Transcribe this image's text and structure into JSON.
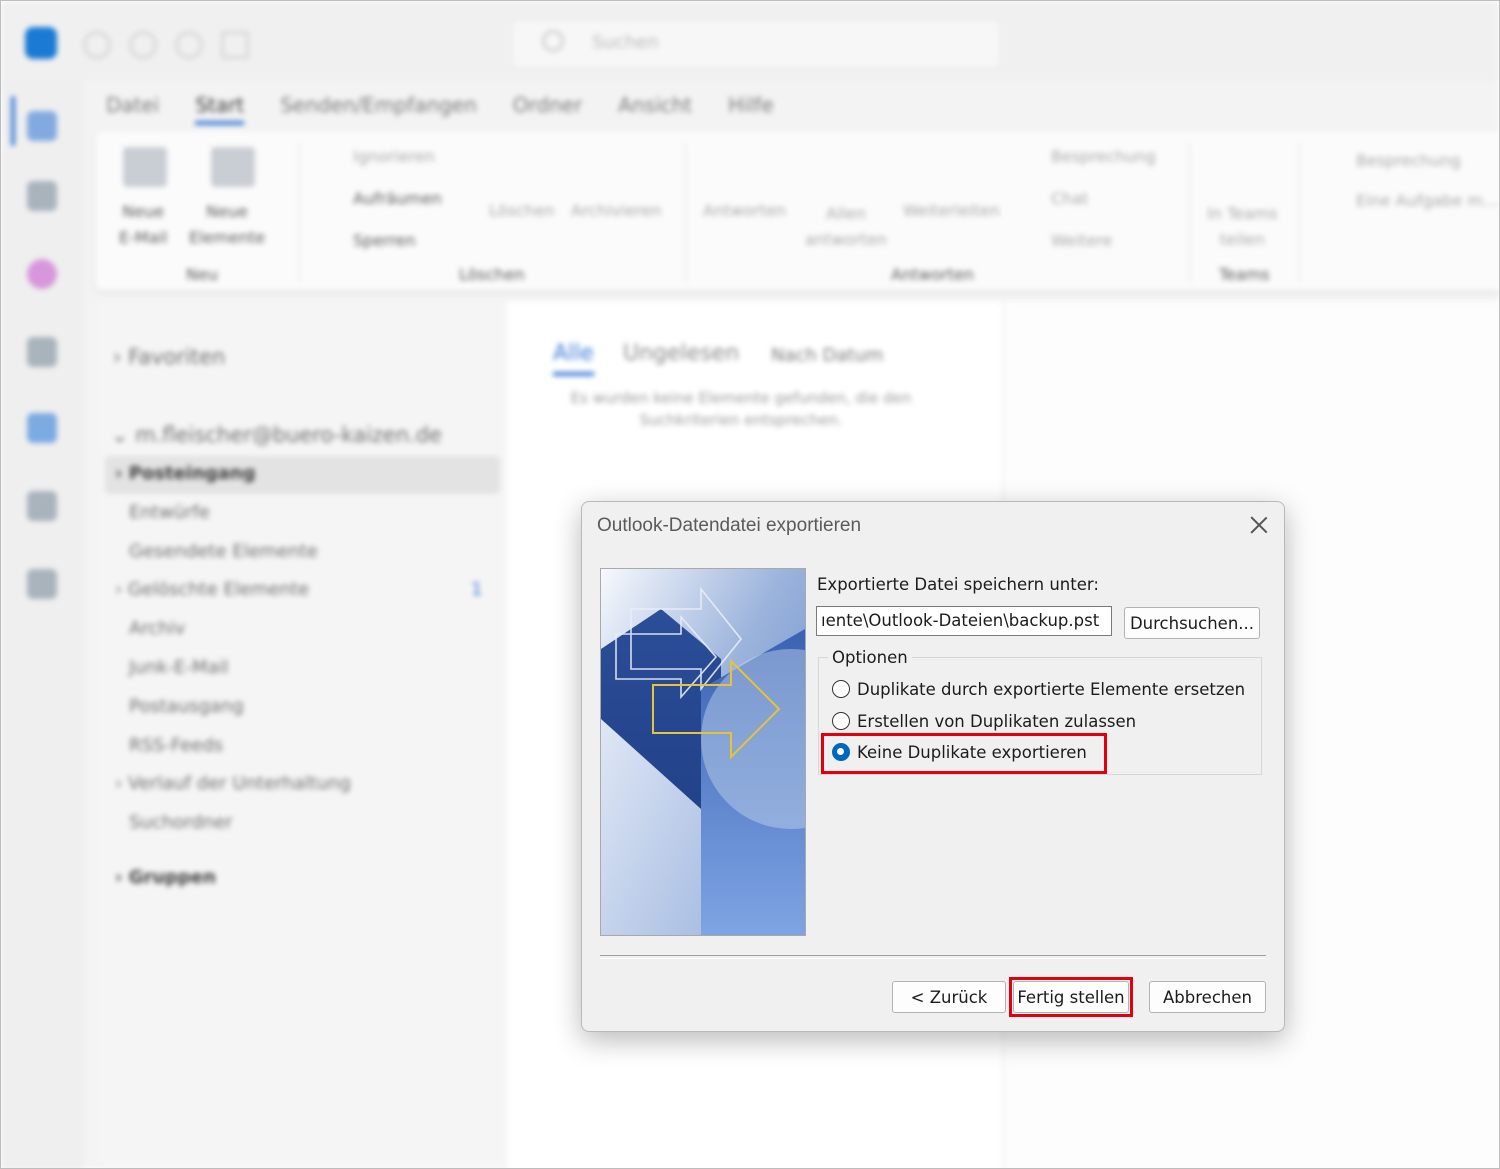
{
  "background": {
    "search_placeholder": "Suchen",
    "menu": [
      "Datei",
      "Start",
      "Senden/Empfangen",
      "Ordner",
      "Ansicht",
      "Hilfe"
    ],
    "active_menu": "Start",
    "ribbon": {
      "new_mail": "Neue\nE-Mail",
      "new_items": "Neue\nElemente",
      "group_new": "Neu",
      "ignore": "Ignorieren",
      "cleanup": "Aufräumen",
      "block": "Sperren",
      "delete": "Löschen",
      "archive": "Archivieren",
      "group_delete": "Löschen",
      "reply": "Antworten",
      "reply_all": "Allen\nantworten",
      "forward": "Weiterleiten",
      "meeting": "Besprechung",
      "chat": "Chat",
      "more": "Weitere",
      "group_reply": "Antworten",
      "share_teams": "In Teams\nteilen",
      "group_teams": "Teams",
      "meeting2": "Besprechung",
      "new_task": "Eine Aufgabe m..."
    },
    "folders": {
      "favorites": "Favoriten",
      "account": "m.fleischer@buero-kaizen.de",
      "items": [
        "Posteingang",
        "Entwürfe",
        "Gesendete Elemente",
        "Gelöschte Elemente",
        "Archiv",
        "Junk-E-Mail",
        "Postausgang",
        "RSS-Feeds",
        "Verlauf der Unterhaltung",
        "Suchordner"
      ],
      "deleted_count": "1",
      "groups": "Gruppen"
    },
    "mail_list": {
      "tab_all": "Alle",
      "tab_unread": "Ungelesen",
      "sort": "Nach Datum",
      "empty_msg": "Es wurden keine Elemente gefunden, die den Suchkriterien entsprechen."
    }
  },
  "dialog": {
    "title": "Outlook-Datendatei exportieren",
    "save_label": "Exportierte Datei speichern unter:",
    "path_value": "ıente\\Outlook-Dateien\\backup.pst",
    "browse": "Durchsuchen...",
    "options_legend": "Optionen",
    "options": [
      {
        "label": "Duplikate durch exportierte Elemente ersetzen",
        "selected": false
      },
      {
        "label": "Erstellen von Duplikaten zulassen",
        "selected": false
      },
      {
        "label": "Keine Duplikate exportieren",
        "selected": true
      }
    ],
    "back": "< Zurück",
    "finish": "Fertig stellen",
    "cancel": "Abbrechen",
    "highlight_color": "#e2000f",
    "accent_color": "#0067c0"
  }
}
